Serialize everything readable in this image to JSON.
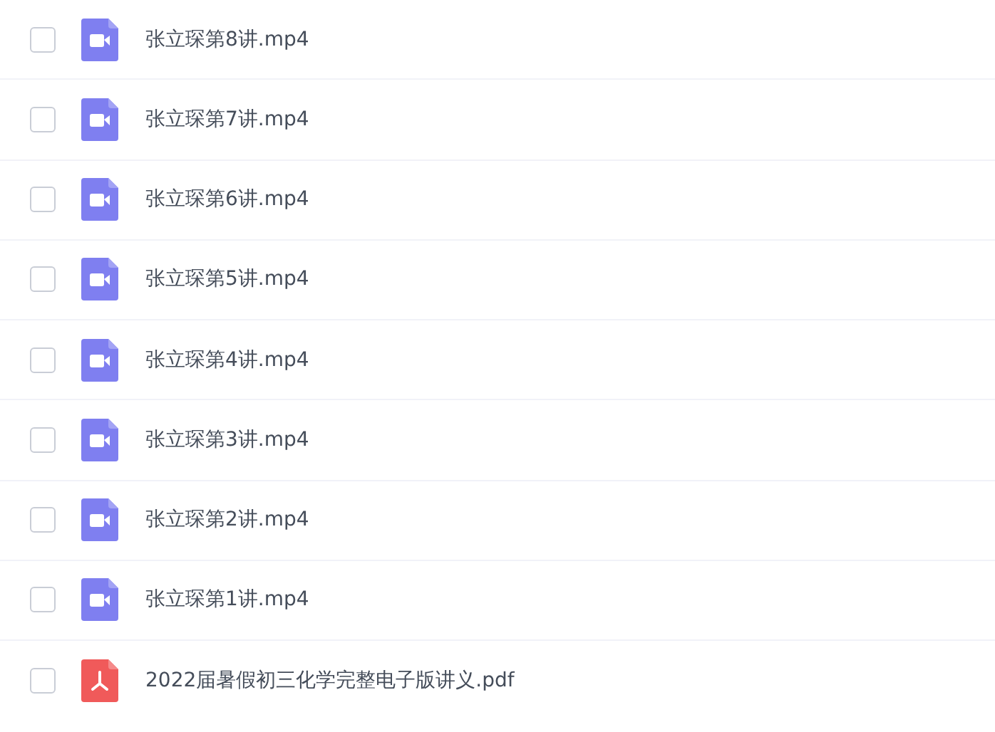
{
  "files": [
    {
      "name": "张立琛第8讲.mp4",
      "kind": "video",
      "checked": false
    },
    {
      "name": "张立琛第7讲.mp4",
      "kind": "video",
      "checked": false
    },
    {
      "name": "张立琛第6讲.mp4",
      "kind": "video",
      "checked": false
    },
    {
      "name": "张立琛第5讲.mp4",
      "kind": "video",
      "checked": false
    },
    {
      "name": "张立琛第4讲.mp4",
      "kind": "video",
      "checked": false
    },
    {
      "name": "张立琛第3讲.mp4",
      "kind": "video",
      "checked": false
    },
    {
      "name": "张立琛第2讲.mp4",
      "kind": "video",
      "checked": false
    },
    {
      "name": "张立琛第1讲.mp4",
      "kind": "video",
      "checked": false
    },
    {
      "name": "2022届暑假初三化学完整电子版讲义.pdf",
      "kind": "pdf",
      "checked": false
    }
  ]
}
